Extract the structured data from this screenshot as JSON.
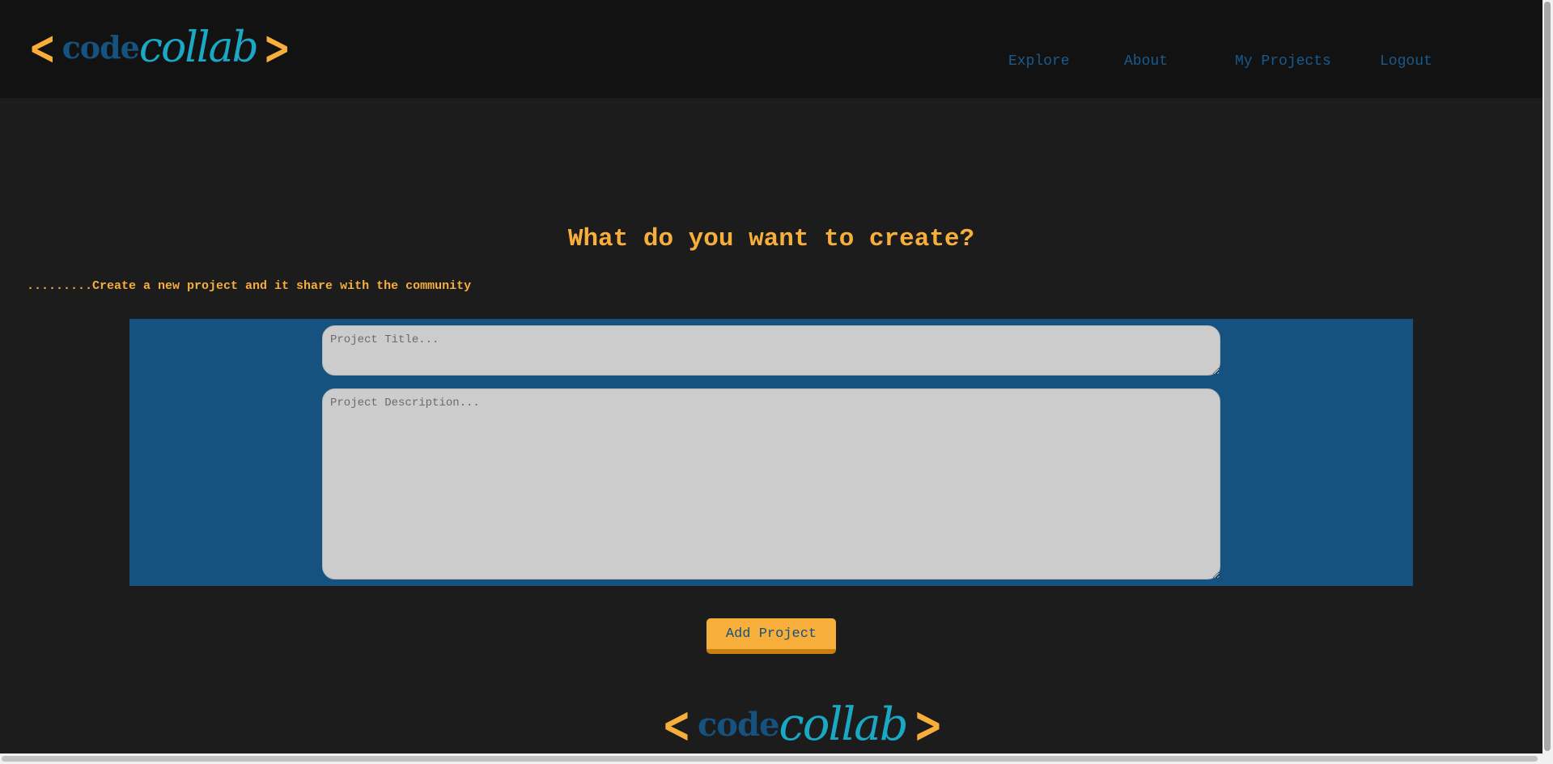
{
  "brand": {
    "bracket_open": "<",
    "word_code": "code",
    "word_collab": "collab",
    "bracket_close": ">",
    "colors": {
      "bracket": "#f7ae3b",
      "code": "#16527f",
      "collab": "#1aa9c4"
    }
  },
  "nav": {
    "items": [
      {
        "label": "Explore"
      },
      {
        "label": "About"
      },
      {
        "label": "My Projects"
      },
      {
        "label": "Logout"
      }
    ]
  },
  "main": {
    "heading": "What do you want to create?",
    "subtitle": ".........Create a new project and it share with the community",
    "form": {
      "title_placeholder": "Project Title...",
      "title_value": "",
      "description_placeholder": "Project Description...",
      "description_value": ""
    },
    "submit_label": "Add Project"
  },
  "colors": {
    "page_bg": "#1c1c1c",
    "header_bg": "#121212",
    "accent_orange": "#f7ae3b",
    "accent_blue": "#16527f",
    "field_bg": "#cccccc"
  }
}
